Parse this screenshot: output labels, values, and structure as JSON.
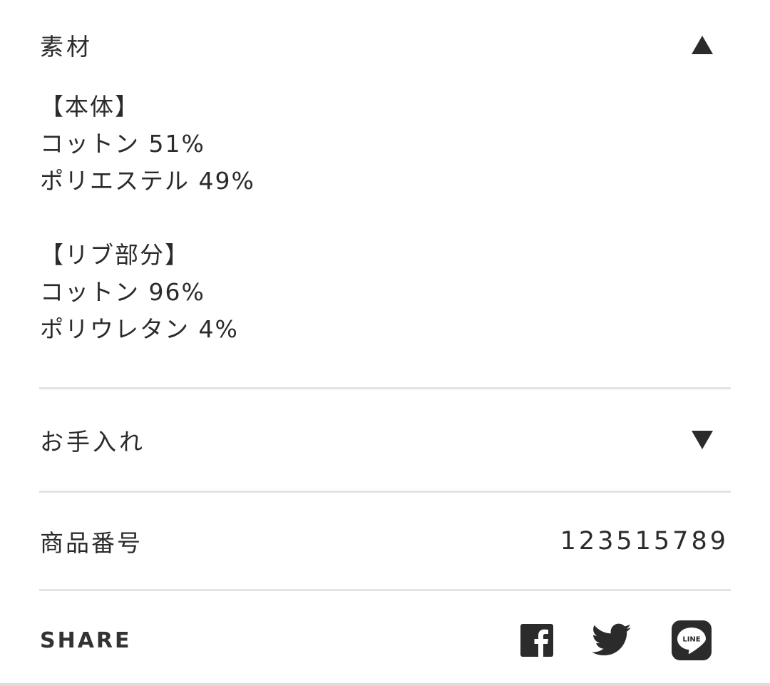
{
  "material": {
    "title": "素材",
    "expanded": true,
    "lines": [
      "【本体】",
      "コットン 51%",
      "ポリエステル 49%",
      "",
      "【リブ部分】",
      "コットン 96%",
      "ポリウレタン 4%"
    ]
  },
  "care": {
    "title": "お手入れ",
    "expanded": false
  },
  "product": {
    "label": "商品番号",
    "value": "123515789"
  },
  "share": {
    "label": "SHARE",
    "icons": [
      "facebook-icon",
      "twitter-icon",
      "line-icon"
    ],
    "line_icon_text": "LINE"
  },
  "colors": {
    "text": "#2b2b2b",
    "divider": "#e3e3e3",
    "icon": "#2b2b2b"
  }
}
